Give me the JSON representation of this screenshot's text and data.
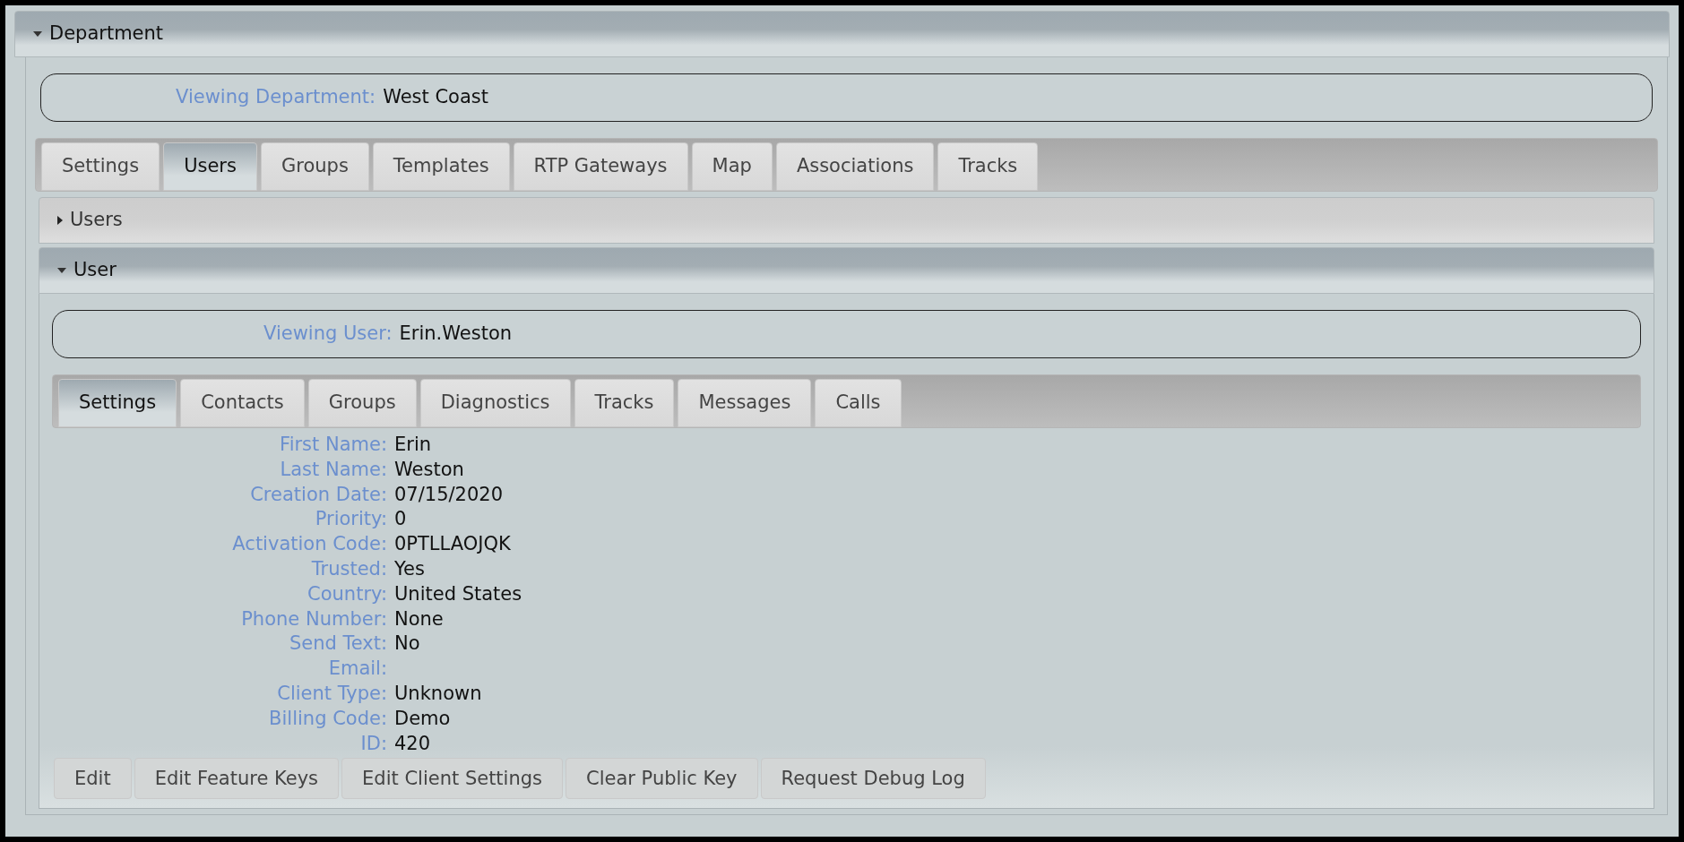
{
  "department": {
    "title": "Department",
    "expanded": true,
    "viewing": {
      "label": "Viewing Department:",
      "value": "West Coast"
    },
    "tabs": [
      {
        "label": "Settings",
        "selected": false
      },
      {
        "label": "Users",
        "selected": true
      },
      {
        "label": "Groups",
        "selected": false
      },
      {
        "label": "Templates",
        "selected": false
      },
      {
        "label": "RTP Gateways",
        "selected": false
      },
      {
        "label": "Map",
        "selected": false
      },
      {
        "label": "Associations",
        "selected": false
      },
      {
        "label": "Tracks",
        "selected": false
      }
    ]
  },
  "users_section": {
    "title": "Users",
    "expanded": false
  },
  "user_section": {
    "title": "User",
    "expanded": true,
    "viewing": {
      "label": "Viewing User:",
      "value": "Erin.Weston"
    },
    "tabs": [
      {
        "label": "Settings",
        "selected": true
      },
      {
        "label": "Contacts",
        "selected": false
      },
      {
        "label": "Groups",
        "selected": false
      },
      {
        "label": "Diagnostics",
        "selected": false
      },
      {
        "label": "Tracks",
        "selected": false
      },
      {
        "label": "Messages",
        "selected": false
      },
      {
        "label": "Calls",
        "selected": false
      }
    ],
    "fields": [
      {
        "label": "First Name:",
        "value": "Erin"
      },
      {
        "label": "Last Name:",
        "value": "Weston"
      },
      {
        "label": "Creation Date:",
        "value": "07/15/2020"
      },
      {
        "label": "Priority:",
        "value": "0"
      },
      {
        "label": "Activation Code:",
        "value": "0PTLLAOJQK"
      },
      {
        "label": "Trusted:",
        "value": "Yes"
      },
      {
        "label": "Country:",
        "value": "United States"
      },
      {
        "label": "Phone Number:",
        "value": "None"
      },
      {
        "label": "Send Text:",
        "value": "No"
      },
      {
        "label": "Email:"
      },
      {
        "label": "Client Type:",
        "value": "Unknown"
      },
      {
        "label": "Billing Code:",
        "value": "Demo"
      },
      {
        "label": "ID:",
        "value": "420"
      }
    ],
    "buttons": [
      "Edit",
      "Edit Feature Keys",
      "Edit Client Settings",
      "Clear Public Key",
      "Request Debug Log"
    ]
  }
}
